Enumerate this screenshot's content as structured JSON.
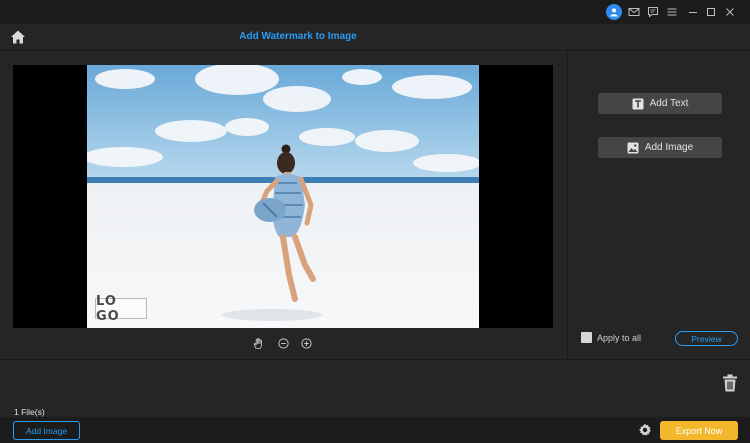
{
  "titlebar": {
    "icons": [
      "user-icon",
      "mail-icon",
      "feedback-icon",
      "menu-icon",
      "minimize-icon",
      "maximize-icon",
      "close-icon"
    ]
  },
  "header": {
    "title": "Add Watermark to Image"
  },
  "preview": {
    "watermark_text": "LO GO",
    "zoom_icons": [
      "hand-icon",
      "zoom-out-icon",
      "zoom-in-icon"
    ]
  },
  "panel": {
    "add_text_label": "Add Text",
    "add_image_label": "Add Image",
    "apply_to_all_label": "Apply to all",
    "apply_to_all_checked": false,
    "preview_label": "Preview"
  },
  "files": {
    "count_label": "1 File(s)"
  },
  "footer": {
    "add_image_label": "Add Image",
    "export_label": "Export Now"
  },
  "colors": {
    "accent": "#2a9cf3",
    "export": "#f2b72b",
    "background": "#252526"
  }
}
